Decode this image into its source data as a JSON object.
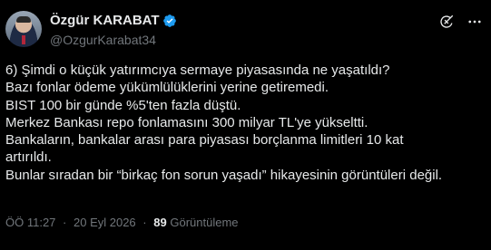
{
  "author": {
    "display_name": "Özgür KARABAT",
    "handle": "@OzgurKarabat34",
    "verified_color": "#1d9bf0"
  },
  "icons": {
    "verified": "verified-badge-icon",
    "grok": "grok-icon",
    "more": "more-options-icon"
  },
  "post": {
    "lines": [
      "6) Şimdi o küçük yatırımcıya sermaye piyasasında ne yaşatıldı?",
      "Bazı fonlar ödeme yükümlülüklerini yerine getiremedi.",
      "BIST 100 bir günde %5'ten fazla düştü.",
      "Merkez Bankası repo fonlamasını 300 milyar TL'ye yükseltti.",
      "Bankaların, bankalar arası para piyasası borçlanma limitleri 10 kat",
      "artırıldı.",
      "Bunlar sıradan bir “birkaç fon sorun yaşadı” hikayesinin görüntüleri değil."
    ]
  },
  "meta": {
    "time": "ÖÖ 11:27",
    "date": "20 Eyl 2026",
    "separator": "·",
    "views_count": "89",
    "views_label": "Görüntüleme"
  },
  "colors": {
    "background": "#000000",
    "text": "#e7e9ea",
    "secondary": "#71767b"
  }
}
